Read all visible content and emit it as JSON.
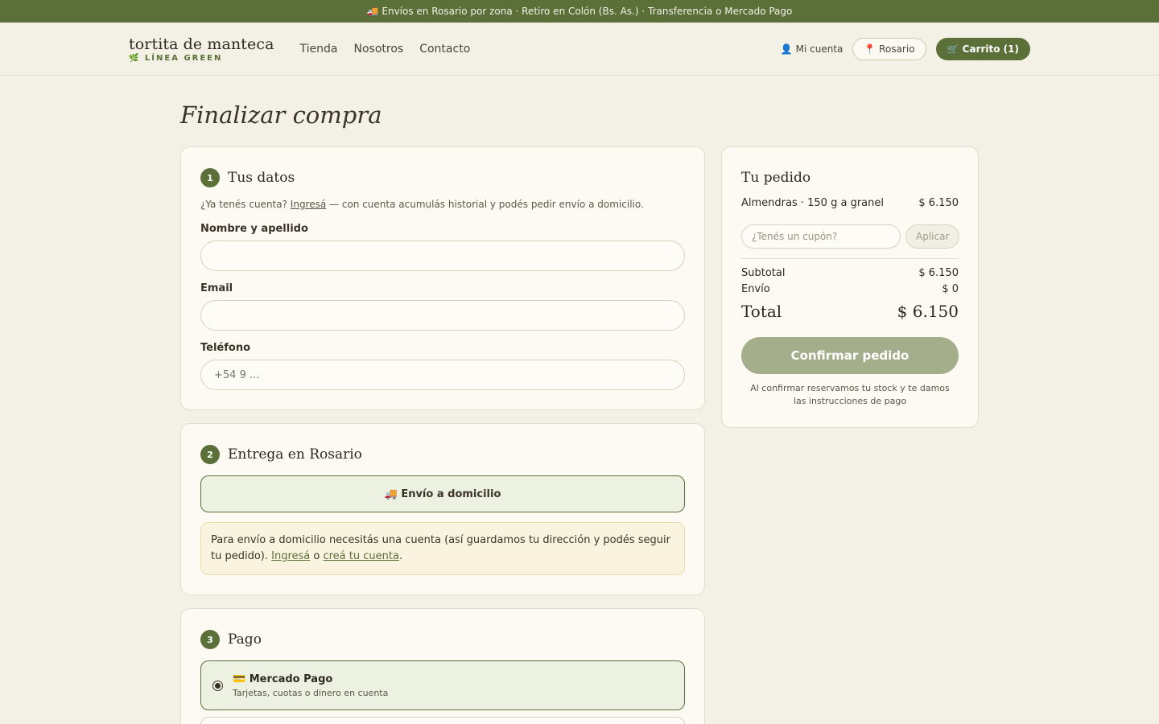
{
  "topbar": {
    "text": "🚚 Envíos en Rosario por zona · Retiro en Colón (Bs. As.) · Transferencia o Mercado Pago"
  },
  "header": {
    "brand_name": "tortita de manteca",
    "brand_sub": "🌿 LÍNEA GREEN",
    "nav": [
      "Tienda",
      "Nosotros",
      "Contacto"
    ],
    "account": "👤 Mi cuenta",
    "location": "📍 Rosario",
    "cart": "🛒 Carrito (1)"
  },
  "page_title": "Finalizar compra",
  "datos": {
    "step": "1",
    "title": "Tus datos",
    "hint_prefix": "¿Ya tenés cuenta? ",
    "hint_link": "Ingresá",
    "hint_suffix": " — con cuenta acumulás historial y podés pedir envío a domicilio.",
    "fields": [
      {
        "label": "Nombre y apellido",
        "placeholder": ""
      },
      {
        "label": "Email",
        "placeholder": ""
      },
      {
        "label": "Teléfono",
        "placeholder": "+54 9 ..."
      }
    ]
  },
  "entrega": {
    "step": "2",
    "title": "Entrega en Rosario",
    "option": "🚚 Envío a domicilio",
    "note_text": "Para envío a domicilio necesitás una cuenta (así guardamos tu dirección y podés seguir tu pedido). ",
    "note_link1": "Ingresá",
    "note_mid": " o ",
    "note_link2": "creá tu cuenta",
    "note_end": "."
  },
  "pago": {
    "step": "3",
    "title": "Pago",
    "option_title": "💳 Mercado Pago",
    "option_sub": "Tarjetas, cuotas o dinero en cuenta"
  },
  "summary": {
    "title": "Tu pedido",
    "item_name": "Almendras · 150 g a granel",
    "item_price": "$ 6.150",
    "coupon_placeholder": "¿Tenés un cupón?",
    "coupon_button": "Aplicar",
    "subtotal_label": "Subtotal",
    "subtotal_value": "$ 6.150",
    "shipping_label": "Envío",
    "shipping_value": "$ 0",
    "total_label": "Total",
    "total_value": "$ 6.150",
    "confirm": "Confirmar pedido",
    "footnote": "Al confirmar reservamos tu stock y te damos las instrucciones de pago"
  }
}
